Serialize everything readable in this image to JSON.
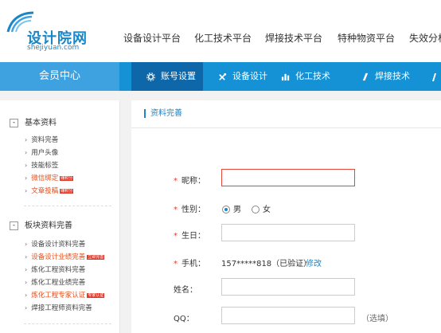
{
  "logo": {
    "name": "设计院网",
    "domain": "shejiyuan.com"
  },
  "top_nav": [
    "设备设计平台",
    "化工技术平台",
    "焊接技术平台",
    "特种物资平台",
    "失效分析"
  ],
  "member_center": "会员中心",
  "tabs": [
    {
      "label": "账号设置",
      "icon": "gear-icon",
      "active": true
    },
    {
      "label": "设备设计",
      "icon": "tools-icon",
      "active": false
    },
    {
      "label": "化工技术",
      "icon": "bar-chart-icon",
      "active": false
    },
    {
      "label": "焊接技术",
      "icon": "welding-icon",
      "active": false
    }
  ],
  "sidebar": {
    "sections": [
      {
        "title": "基本资料",
        "toggle": "-",
        "items": [
          {
            "label": "资料完善",
            "tag": ""
          },
          {
            "label": "用户头像",
            "tag": ""
          },
          {
            "label": "技能标签",
            "tag": ""
          },
          {
            "label": "微信绑定",
            "tag": "赚积分"
          },
          {
            "label": "文章投稿",
            "tag": "赚积分"
          }
        ]
      },
      {
        "title": "板块资料完善",
        "toggle": "-",
        "items": [
          {
            "label": "设备设计资料完善",
            "tag": ""
          },
          {
            "label": "设备设计业绩完善",
            "tag": "立即完善"
          },
          {
            "label": "炼化工程资料完善",
            "tag": ""
          },
          {
            "label": "炼化工程业绩完善",
            "tag": ""
          },
          {
            "label": "炼化工程专家认证",
            "tag": "专家认证"
          },
          {
            "label": "焊接工程师资料完善",
            "tag": ""
          }
        ]
      }
    ]
  },
  "main": {
    "title": "资料完善",
    "form": {
      "nickname_label": "昵称：",
      "gender_label": "性别：",
      "gender_male": "男",
      "gender_female": "女",
      "gender_selected": "男",
      "birthday_label": "生日：",
      "phone_label": "手机：",
      "phone_value": "157*****818（已验证）",
      "phone_edit": "修改",
      "name_label": "姓名：",
      "qq_label": "QQ：",
      "qq_hint": "（选填）",
      "required_mark": "*"
    }
  },
  "colors": {
    "brand_blue": "#1591d6",
    "active_tab": "#0d67a8",
    "member_center_bg": "#3fa2e0",
    "highlight_orange": "#e0501f",
    "required_red": "#e03a2b"
  }
}
